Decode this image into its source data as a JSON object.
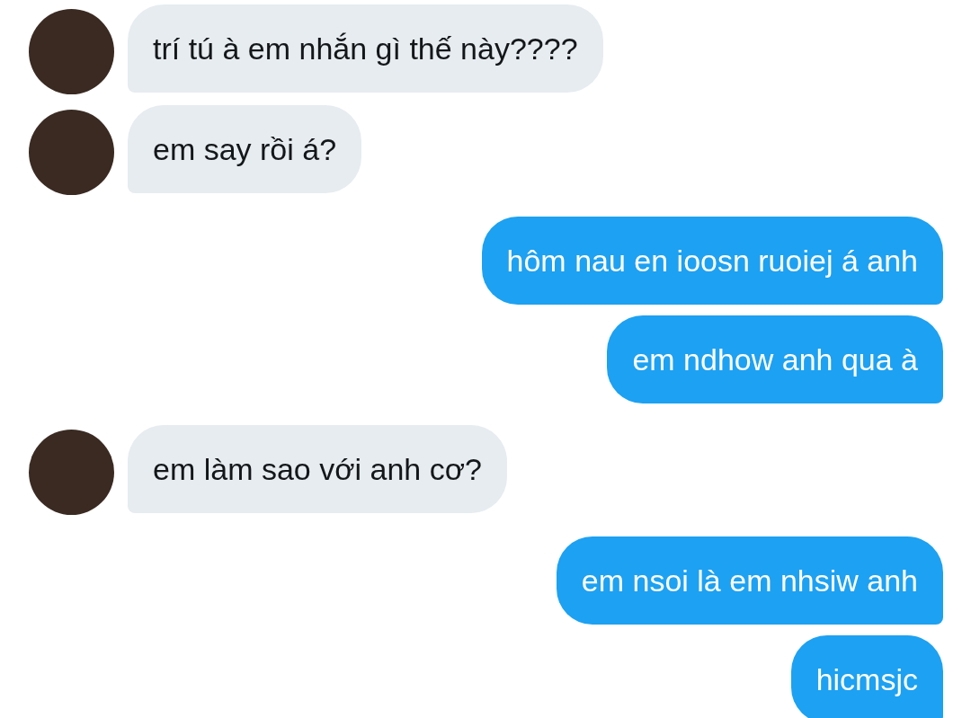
{
  "messages": [
    {
      "kind": "incoming",
      "text": "trí tú à em nhắn gì thế này????"
    },
    {
      "kind": "incoming",
      "text": "em say rồi á?"
    },
    {
      "kind": "outgoing",
      "text": "hôm nau en ioosn ruoiej á anh"
    },
    {
      "kind": "outgoing",
      "text": "em ndhow anh qua à"
    },
    {
      "kind": "incoming",
      "text": "em làm sao với anh cơ?"
    },
    {
      "kind": "outgoing",
      "text": "em nsoi là em nhsiw anh"
    },
    {
      "kind": "outgoing",
      "text": "hicmsjc"
    }
  ]
}
